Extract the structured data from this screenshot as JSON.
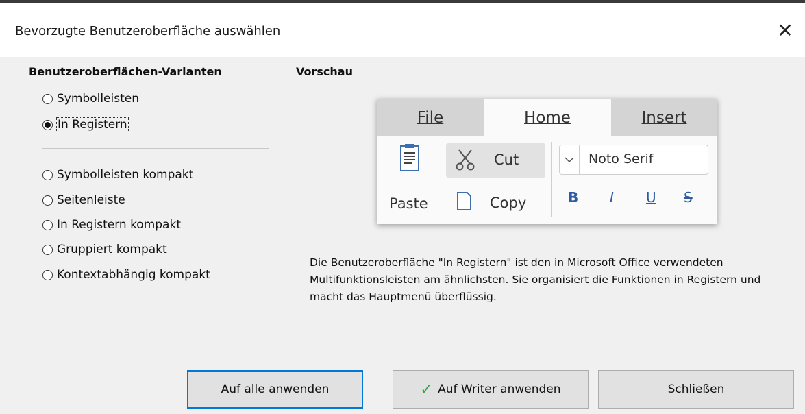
{
  "window": {
    "title": "Bevorzugte Benutzeroberfläche auswählen",
    "close_symbol": "✕"
  },
  "variants": {
    "heading": "Benutzeroberflächen-Varianten",
    "options": [
      {
        "label": "Symbolleisten",
        "selected": false
      },
      {
        "label": "In Registern",
        "selected": true
      },
      {
        "label": "Symbolleisten kompakt",
        "selected": false
      },
      {
        "label": "Seitenleiste",
        "selected": false
      },
      {
        "label": "In Registern kompakt",
        "selected": false
      },
      {
        "label": "Gruppiert kompakt",
        "selected": false
      },
      {
        "label": "Kontextabhängig kompakt",
        "selected": false
      }
    ]
  },
  "preview": {
    "heading": "Vorschau",
    "tabs": [
      {
        "label": "File",
        "active": false
      },
      {
        "label": "Home",
        "active": true
      },
      {
        "label": "Insert",
        "active": false
      }
    ],
    "paste": "Paste",
    "cut": "Cut",
    "copy": "Copy",
    "font": "Noto Serif",
    "format": {
      "bold": "B",
      "italic": "I",
      "underline": "U",
      "strike": "S"
    }
  },
  "description": "Die Benutzeroberfläche \"In Registern\" ist den in Microsoft Office verwendeten Multifunktionsleisten am ähnlichsten. Sie organisiert die Funktionen in Registern und macht das Hauptmenü überflüssig.",
  "buttons": {
    "apply_all": "Auf alle anwenden",
    "apply_writer": "Auf Writer anwenden",
    "close": "Schließen"
  },
  "colors": {
    "accent": "#0078d7",
    "check": "#25a244",
    "format": "#2d5aa0"
  }
}
